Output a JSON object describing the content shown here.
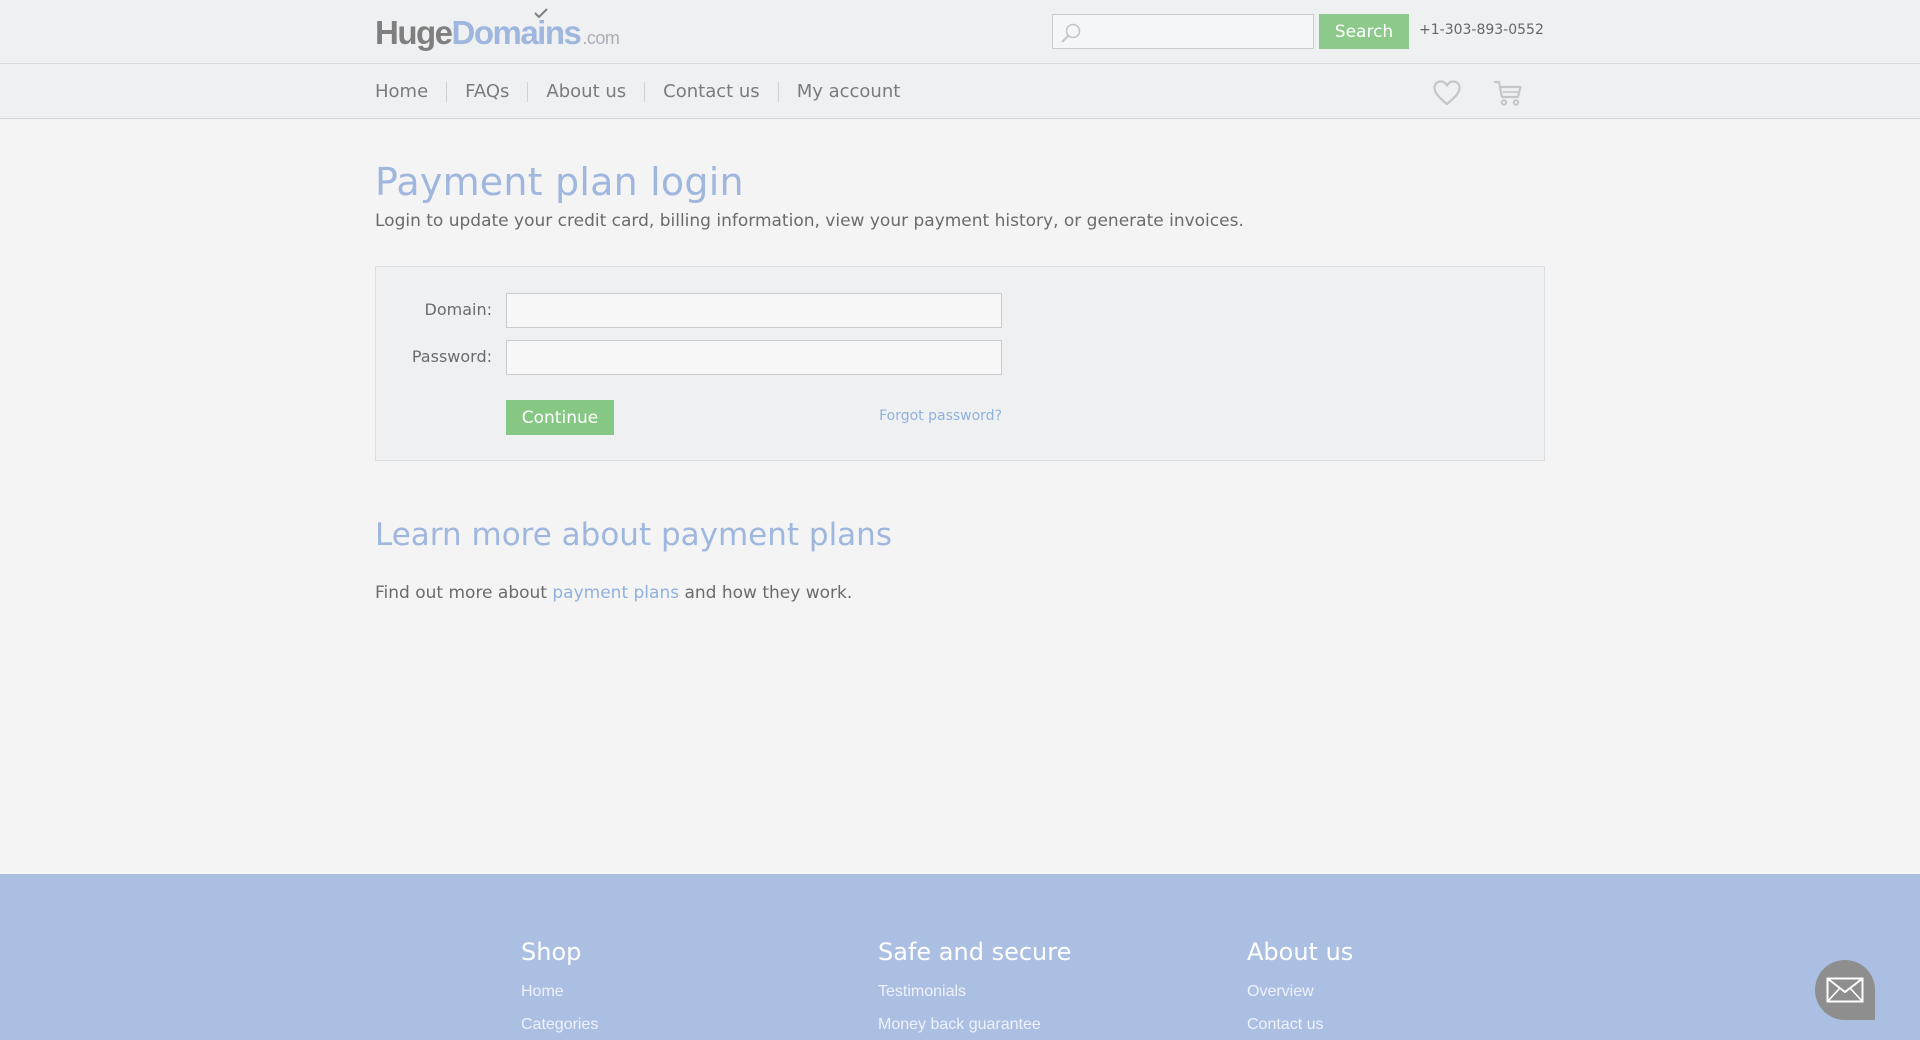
{
  "header": {
    "logo": {
      "part1": "Huge",
      "part2": "Domains",
      "suffix": ".com"
    },
    "search": {
      "placeholder": "",
      "value": "",
      "button_label": "Search"
    },
    "phone": "+1-303-893-0552"
  },
  "nav": {
    "items": [
      {
        "label": "Home"
      },
      {
        "label": "FAQs"
      },
      {
        "label": "About us"
      },
      {
        "label": "Contact us"
      },
      {
        "label": "My account"
      }
    ],
    "icons": [
      "heart-icon",
      "cart-icon"
    ]
  },
  "main": {
    "title": "Payment plan login",
    "subtitle": "Login to update your credit card, billing information, view your payment history, or generate invoices.",
    "form": {
      "domain_label": "Domain:",
      "domain_value": "",
      "password_label": "Password:",
      "password_value": "",
      "continue_label": "Continue",
      "forgot_label": "Forgot password?"
    },
    "learn_more": {
      "title": "Learn more about payment plans",
      "text_before": "Find out more about ",
      "link": "payment plans",
      "text_after": " and how they work."
    }
  },
  "footer": {
    "columns": [
      {
        "title": "Shop",
        "links": [
          "Home",
          "Categories"
        ]
      },
      {
        "title": "Safe and secure",
        "links": [
          "Testimonials",
          "Money back guarantee"
        ]
      },
      {
        "title": "About us",
        "links": [
          "Overview",
          "Contact us"
        ]
      }
    ],
    "chat_icon": "envelope-icon"
  },
  "colors": {
    "accent_blue": "#9fb7de",
    "link_blue": "#8fb1dc",
    "button_green": "#86c784",
    "footer_bg": "#abbfe3"
  }
}
